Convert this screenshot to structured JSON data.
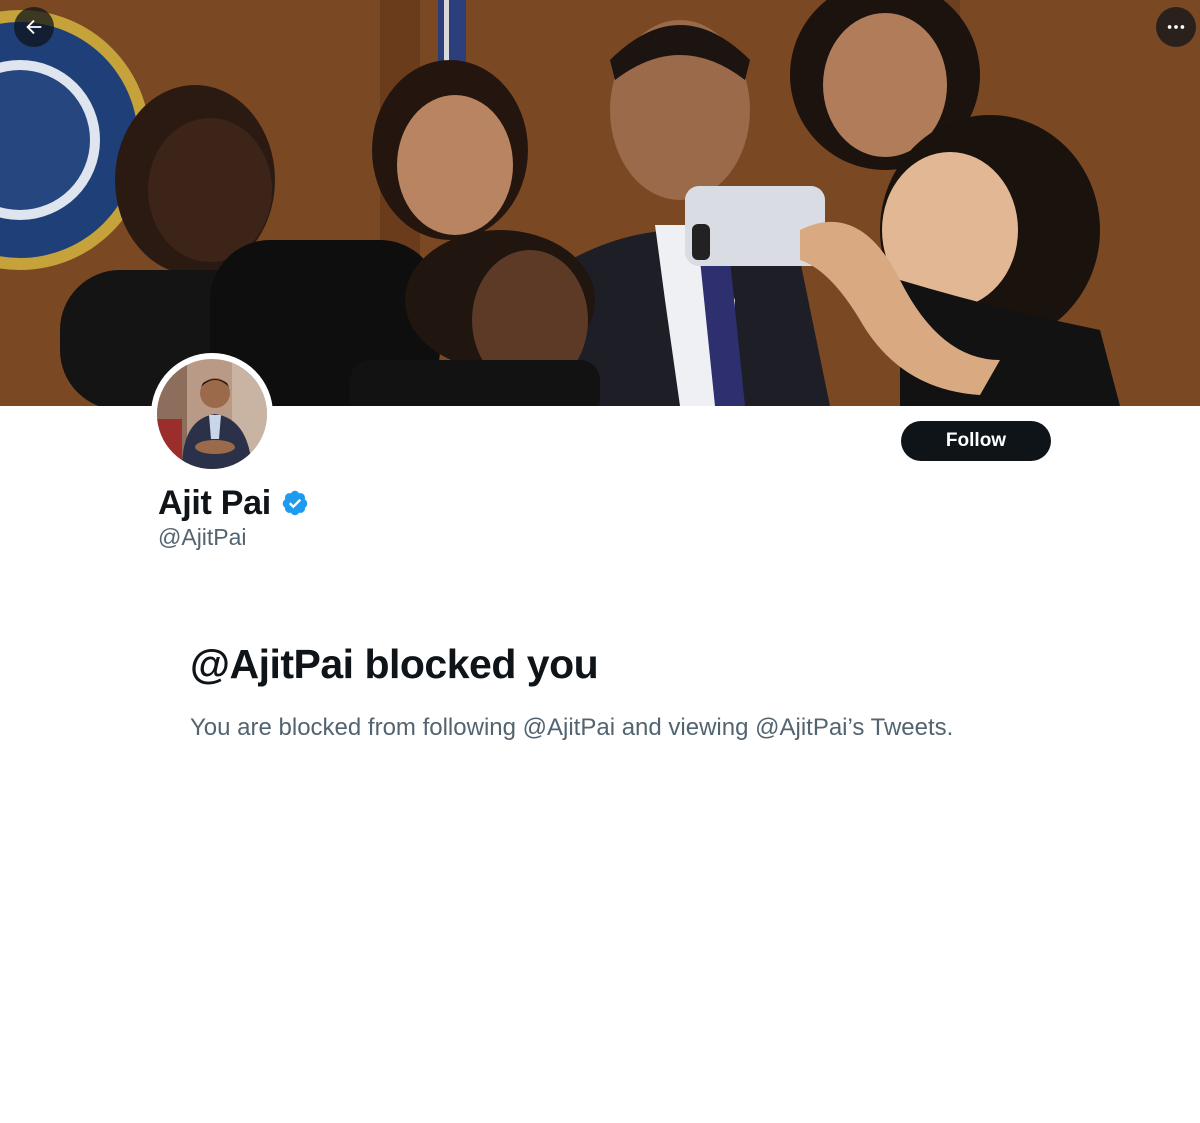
{
  "banner": {
    "back_icon": "arrow-left-icon",
    "more_icon": "more-horizontal-icon"
  },
  "profile": {
    "display_name": "Ajit Pai",
    "handle": "@AjitPai",
    "verified": true,
    "verified_icon": "verified-badge-icon",
    "follow_label": "Follow"
  },
  "blocked": {
    "title": "@AjitPai blocked you",
    "message": "You are blocked from following @AjitPai and viewing @AjitPai’s Tweets."
  },
  "colors": {
    "primary_text": "#0f1419",
    "secondary_text": "#536471",
    "verified_blue": "#1d9bf0",
    "background": "#ffffff"
  }
}
